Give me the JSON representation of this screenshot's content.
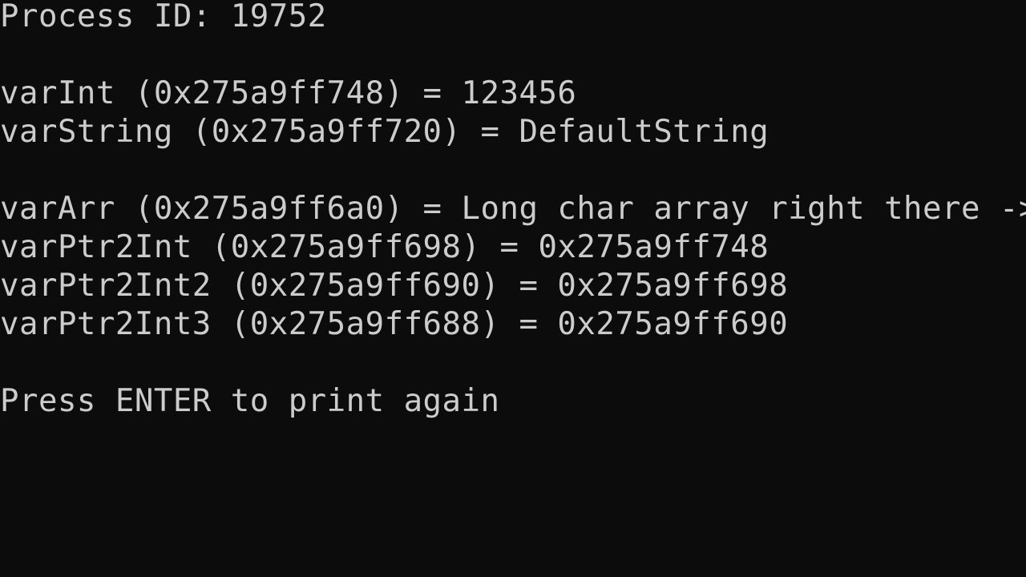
{
  "console": {
    "lines": [
      "Process ID: 19752",
      "varInt (0x275a9ff748) = 123456",
      "varString (0x275a9ff720) = DefaultString",
      "varArr (0x275a9ff6a0) = Long char array right there ->",
      "varPtr2Int (0x275a9ff698) = 0x275a9ff748",
      "varPtr2Int2 (0x275a9ff690) = 0x275a9ff698",
      "varPtr2Int3 (0x275a9ff688) = 0x275a9ff690",
      "Press ENTER to print again"
    ]
  },
  "colors": {
    "background": "#0c0c0c",
    "text": "#cccccc"
  }
}
